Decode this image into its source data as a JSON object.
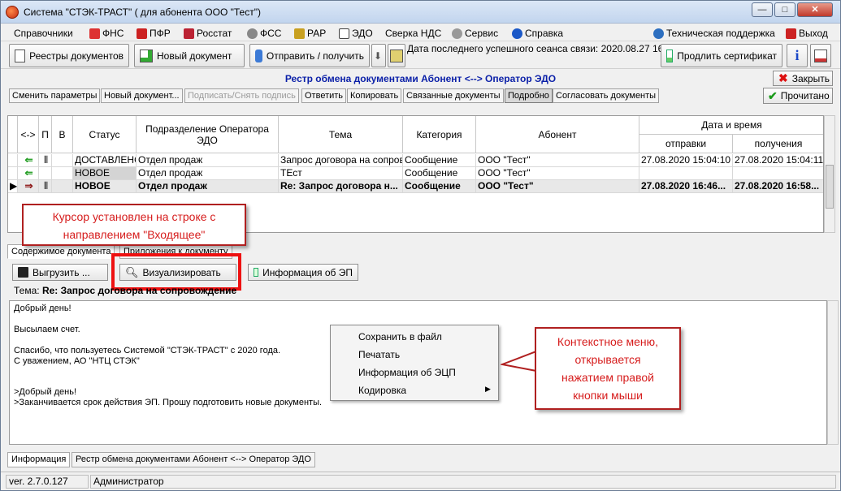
{
  "window": {
    "title": "Система \"СТЭК-ТРАСТ\" ( для абонента ООО \"Тест\")",
    "min": "—",
    "max": "□",
    "close": "✕"
  },
  "menu": [
    "Справочники",
    "ФНС",
    "ПФР",
    "Росстат",
    "ФСС",
    "РАР",
    "ЭДО",
    "Сверка НДС",
    "Сервис",
    "Справка"
  ],
  "menu_right": [
    "Техническая поддержка",
    "Выход"
  ],
  "toolbar": {
    "registers": "Реестры документов",
    "new_doc": "Новый документ",
    "send_receive": "Отправить / получить",
    "last_session": "Дата последнего успешного сеанса связи: 2020.08.27 16:58",
    "extend_cert": "Продлить сертификат",
    "info_icon": "i"
  },
  "registry_title": "Рестр обмена документами Абонент <--> Оператор ЭДО",
  "close_button": "Закрыть",
  "actions": [
    "Сменить параметры",
    "Новый документ...",
    "Подписать/Снять подпись",
    "Ответить",
    "Копировать",
    "Связанные документы",
    "Подробно",
    "Согласовать документы"
  ],
  "read_button": "Прочитано",
  "grid": {
    "headers": {
      "dir": "<->",
      "p": "П",
      "v": "В",
      "status": "Статус",
      "dept": "Подразделение Оператора ЭДО",
      "subject": "Тема",
      "category": "Категория",
      "subscriber": "Абонент",
      "datetime": "Дата и время",
      "sent": "отправки",
      "received": "получения"
    },
    "rows": [
      {
        "status": "ДОСТАВЛЕНО",
        "dept": "Отдел продаж",
        "subject": "Запрос договора на сопров...",
        "category": "Сообщение",
        "subscriber": "ООО \"Тест\"",
        "sent": "27.08.2020 15:04:10",
        "received": "27.08.2020 15:04:11"
      },
      {
        "status": "НОВОЕ",
        "dept": "Отдел продаж",
        "subject": "ТЕст",
        "category": "Сообщение",
        "subscriber": "ООО \"Тест\"",
        "sent": "",
        "received": ""
      },
      {
        "status": "НОВОЕ",
        "dept": "Отдел продаж",
        "subject": "Re: Запрос договора н...",
        "category": "Сообщение",
        "subscriber": "ООО \"Тест\"",
        "sent": "27.08.2020 16:46...",
        "received": "27.08.2020 16:58..."
      }
    ]
  },
  "callout_cursor": [
    "Курсор установлен на строке с",
    "направлением \"Входящее\""
  ],
  "tabs": [
    "Содержимое документа",
    "Приложения к документу"
  ],
  "content_buttons": {
    "export": "Выгрузить ...",
    "visualize": "Визуализировать",
    "sig_info": "Информация об ЭП"
  },
  "subject": {
    "label": "Тема:",
    "value": "Re: Запрос договора на сопровождение"
  },
  "body_lines": [
    "Добрый день!",
    "Высылаем счет.",
    "Спасибо, что пользуетесь Системой \"СТЭК-ТРАСТ\" с 2020 года.",
    "С уважением, АО \"НТЦ СТЭК\"",
    ">Добрый день!",
    ">Заканчивается срок действия ЭП. Прошу подготовить новые документы."
  ],
  "context_menu": [
    "Сохранить в файл",
    "Печатать",
    "Информация об ЭЦП",
    "Кодировка"
  ],
  "callout_menu": [
    "Контекстное меню,",
    "открывается",
    "нажатием правой",
    "кнопки мыши"
  ],
  "bottom_tabs": [
    "Информация",
    "Рестр обмена документами Абонент <--> Оператор ЭДО"
  ],
  "status": {
    "version": "ver. 2.7.0.127",
    "user": "Администратор"
  }
}
